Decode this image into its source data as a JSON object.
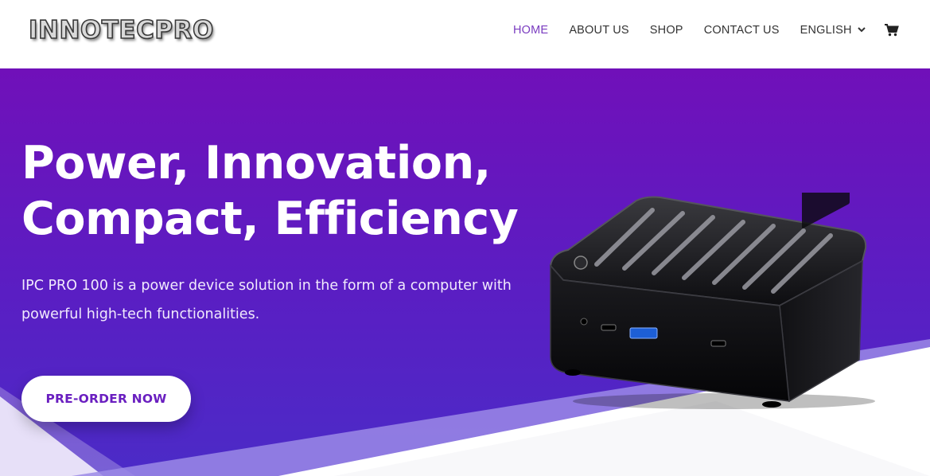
{
  "header": {
    "logo_text": "INNOTECPRO",
    "nav": [
      {
        "label": "HOME",
        "active": true
      },
      {
        "label": "ABOUT US",
        "active": false
      },
      {
        "label": "SHOP",
        "active": false
      },
      {
        "label": "CONTACT US",
        "active": false
      },
      {
        "label": "ENGLISH",
        "active": false
      }
    ],
    "language_dropdown_icon": "chevron-down-icon",
    "cart_icon": "cart-icon"
  },
  "hero": {
    "headline_line1": "Power, Innovation,",
    "headline_line2": "Compact, Efficiency",
    "description_line1": "IPC PRO 100 is a power device solution in the form of a computer with",
    "description_line2": "powerful high-tech functionalities.",
    "cta_label": "PRE-ORDER NOW",
    "product_image": "mini-pc-image"
  },
  "colors": {
    "nav_active": "#7a3cc0",
    "hero_top": "#7010b9",
    "hero_bottom": "#4b2bc7",
    "cta_text": "#6a1fc0"
  }
}
